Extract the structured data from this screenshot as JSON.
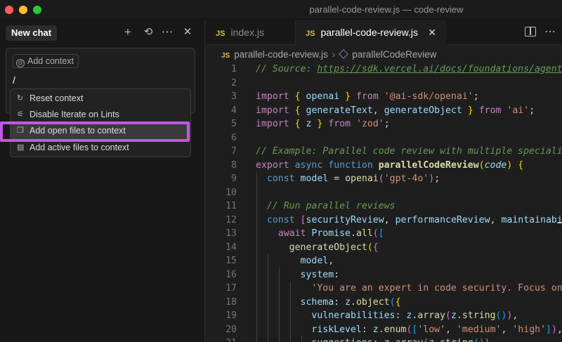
{
  "window": {
    "title": "parallel-code-review.js — code-review"
  },
  "chat": {
    "new_chat_label": "New chat",
    "add_context_label": "Add context",
    "input_value": "/",
    "menu": [
      {
        "label": "Reset context",
        "icon": "reset-icon"
      },
      {
        "label": "Disable Iterate on Lints",
        "icon": "sliders-icon"
      },
      {
        "label": "Add open files to context",
        "icon": "copy-files-icon"
      },
      {
        "label": "Add active files to context",
        "icon": "file-icon"
      }
    ],
    "highlight_color": "#c058e8"
  },
  "editor": {
    "tabs": [
      {
        "label": "index.js",
        "badge": "JS"
      },
      {
        "label": "parallel-code-review.js",
        "badge": "JS"
      }
    ],
    "breadcrumb": {
      "file": "parallel-code-review.js",
      "badge": "JS",
      "symbol": "parallelCodeReview"
    },
    "line_numbers": [
      "1",
      "2",
      "3",
      "4",
      "5",
      "6",
      "7",
      "8",
      "9",
      "10",
      "11",
      "12",
      "13",
      "14",
      "15",
      "16",
      "17",
      "18",
      "19",
      "20",
      "21"
    ]
  }
}
